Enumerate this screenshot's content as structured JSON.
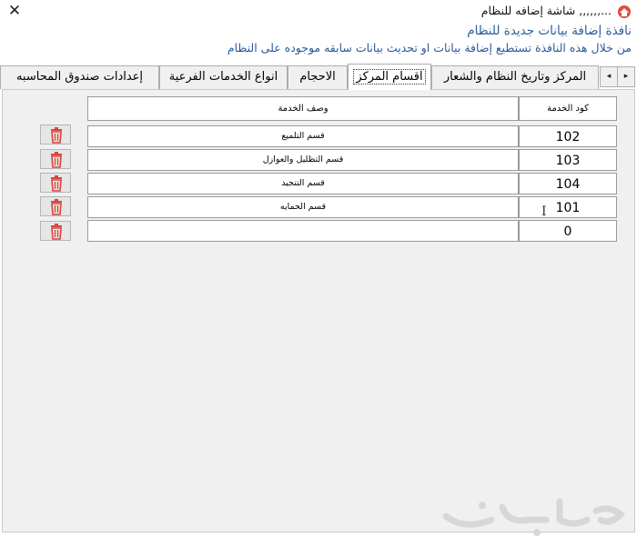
{
  "window": {
    "title": "...,,,,,, شاشة إضافه للنظام",
    "close_glyph": "✕"
  },
  "header": {
    "line1": "نافذة إضافة بيانات جديدة للنظام",
    "line2": "من خلال هذه النافذة تستطيع إضافة بيانات او تحديث بيانات سابقه موجوده على النظام"
  },
  "tabs": [
    {
      "label": "المركز وتاريخ النظام والشعار",
      "active": false
    },
    {
      "label": "اقسام المركز",
      "active": true
    },
    {
      "label": "الاحجام",
      "active": false
    },
    {
      "label": "انواع الخدمات الفرعية",
      "active": false
    },
    {
      "label": "إعدادات صندوق المحاسبه",
      "active": false
    }
  ],
  "tab_scroll": {
    "left": "◂",
    "right": "▸"
  },
  "grid": {
    "columns": {
      "code": "كود الخدمة",
      "description": "وصف الخدمة"
    },
    "rows": [
      {
        "code": "102",
        "description": "قسم التلميع"
      },
      {
        "code": "103",
        "description": "قسم التظليل والعوازل"
      },
      {
        "code": "104",
        "description": "قسم التنجيد"
      },
      {
        "code": "101",
        "description": "قسم الحمايه"
      },
      {
        "code": "0",
        "description": ""
      }
    ]
  },
  "colors": {
    "header_text": "#2b5a9b",
    "delete_icon": "#d9453a",
    "panel_bg": "#f0f0f0"
  },
  "icons": {
    "close": "close-icon",
    "delete": "trash-icon",
    "app": "app-icon",
    "watermark": "haraj-watermark-logo"
  }
}
